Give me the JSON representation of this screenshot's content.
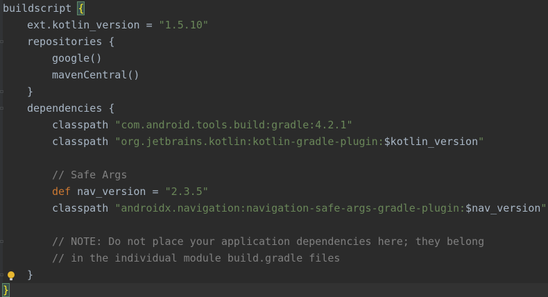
{
  "editor": {
    "language": "gradle",
    "lines": [
      {
        "text": "buildscript"
      },
      {
        "key": "ext.kotlin_version",
        "eq": " = ",
        "value": "\"1.5.10\""
      },
      {
        "text": "repositories {"
      },
      {
        "text": "google()"
      },
      {
        "text": "mavenCentral()"
      },
      {
        "text": "}"
      },
      {
        "text": "dependencies {"
      },
      {
        "kw": "classpath",
        "value": "\"com.android.tools.build:gradle:4.2.1\""
      },
      {
        "kw": "classpath",
        "value": "\"org.jetbrains.kotlin:kotlin-gradle-plugin:",
        "var": "$kotlin_version",
        "end": "\""
      },
      {
        "text": ""
      },
      {
        "comment": "// Safe Args"
      },
      {
        "kw": "def",
        "key": " nav_version",
        "eq": " = ",
        "value": "\"2.3.5\""
      },
      {
        "kw": "classpath",
        "value": "\"androidx.navigation:navigation-safe-args-gradle-plugin:",
        "var": "$nav_version",
        "end": "\""
      },
      {
        "text": ""
      },
      {
        "comment": "// NOTE: Do not place your application dependencies here; they belong"
      },
      {
        "comment": "// in the individual module build.gradle files"
      },
      {
        "text": "}"
      },
      {
        "text": "}"
      }
    ],
    "open_brace": "{"
  },
  "colors": {
    "background": "#2b2b2b",
    "text": "#a9b7c6",
    "string": "#6a8759",
    "keyword": "#cc7832",
    "comment": "#808080",
    "brace_highlight": "#ffef28"
  },
  "icons": {
    "intention_bulb": "lightbulb-icon",
    "fold_marker": "fold-marker-icon"
  }
}
